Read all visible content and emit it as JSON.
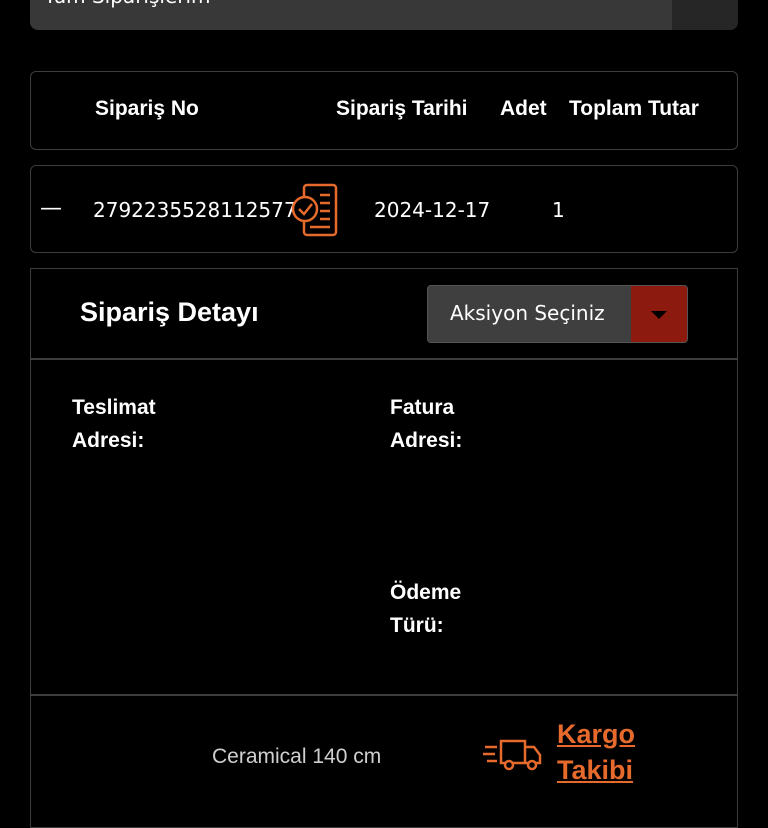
{
  "filter": {
    "selected": "Tüm Siparişlerim"
  },
  "table_header": {
    "columns": [
      "Sipariş No",
      "Sipariş Tarihi",
      "Adet",
      "Toplam Tutar"
    ]
  },
  "order": {
    "collapse_symbol": "—",
    "order_no": "2792235528112577",
    "date": "2024-12-17",
    "quantity": "1",
    "total": ""
  },
  "detail": {
    "title": "Sipariş Detayı",
    "action_placeholder": "Aksiyon Seçiniz",
    "delivery_address_label_1": "Teslimat",
    "delivery_address_label_2": "Adresi:",
    "invoice_address_label_1": "Fatura",
    "invoice_address_label_2": "Adresi:",
    "payment_type_label_1": "Ödeme",
    "payment_type_label_2": "Türü:"
  },
  "item": {
    "product_name": "Ceramical 140 cm",
    "tracking_link_line1": "Kargo",
    "tracking_link_line2": "Takibi"
  },
  "colors": {
    "background": "#000000",
    "accent_orange": "#e66a2c",
    "dropdown_red": "#8d1a0f",
    "border": "#3d3d3d"
  },
  "icons": {
    "order_doc": "checked-document-icon",
    "truck": "fast-delivery-truck-icon",
    "dropdown": "caret-down-icon"
  }
}
